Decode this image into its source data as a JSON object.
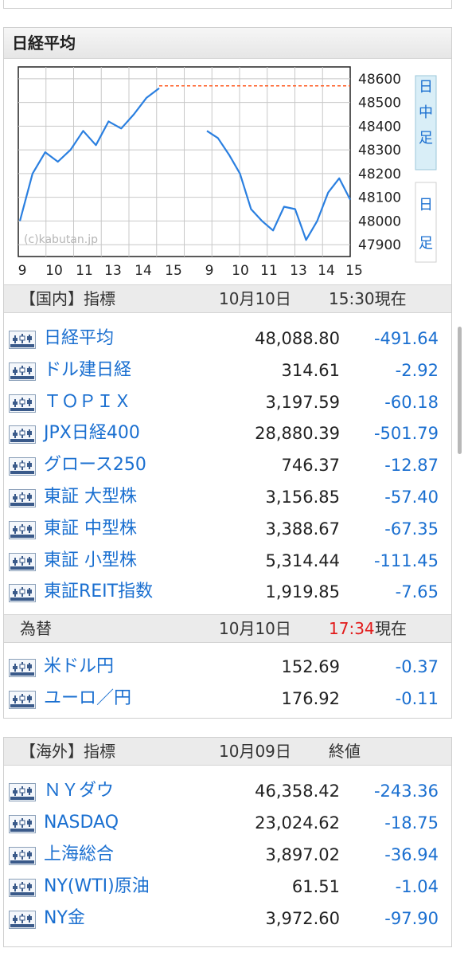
{
  "nikkei_panel": {
    "title": "日経平均",
    "chart": {
      "watermark": "(c)kabutan.jp",
      "right_labels": [
        "日",
        "中",
        "足",
        "日",
        "足"
      ],
      "y_ticks": [
        "48600",
        "48500",
        "48400",
        "48300",
        "48200",
        "48100",
        "48000",
        "47900"
      ],
      "x_ticks_left": [
        "9",
        "10",
        "11",
        "13",
        "14",
        "15"
      ],
      "x_ticks_right": [
        "9",
        "10",
        "11",
        "13",
        "14",
        "15"
      ]
    },
    "chart_data": {
      "type": "line",
      "ylim": [
        47850,
        48650
      ],
      "reference_line": 48570,
      "series": [
        {
          "values": [
            48000,
            48200,
            48290,
            48250,
            48300,
            48380,
            48320,
            48420,
            48390,
            48450,
            48520,
            48560
          ]
        },
        {
          "values": [
            48380,
            48350,
            48280,
            48200,
            48050,
            48000,
            47960,
            48060,
            48050,
            47920,
            48000,
            48120,
            48180,
            48090
          ]
        }
      ]
    },
    "domestic_header": {
      "label": "【国内】指標",
      "date": "10月10日",
      "time": "15:30現在"
    },
    "domestic_rows": [
      {
        "name": "日経平均",
        "value": "48,088.80",
        "change": "-491.64"
      },
      {
        "name": "ドル建日経",
        "value": "314.61",
        "change": "-2.92"
      },
      {
        "name": "ＴＯＰＩＸ",
        "value": "3,197.59",
        "change": "-60.18"
      },
      {
        "name": "JPX日経400",
        "value": "28,880.39",
        "change": "-501.79"
      },
      {
        "name": "グロース250",
        "value": "746.37",
        "change": "-12.87"
      },
      {
        "name": "東証 大型株",
        "value": "3,156.85",
        "change": "-57.40"
      },
      {
        "name": "東証 中型株",
        "value": "3,388.67",
        "change": "-67.35"
      },
      {
        "name": "東証 小型株",
        "value": "5,314.44",
        "change": "-111.45"
      },
      {
        "name": "東証REIT指数",
        "value": "1,919.85",
        "change": "-7.65"
      }
    ],
    "fx_header": {
      "label": "為替",
      "date": "10月10日",
      "time": "17:34",
      "suffix": "現在"
    },
    "fx_rows": [
      {
        "name": "米ドル円",
        "value": "152.69",
        "change": "-0.37"
      },
      {
        "name": "ユーロ／円",
        "value": "176.92",
        "change": "-0.11"
      }
    ]
  },
  "overseas_panel": {
    "header": {
      "label": "【海外】指標",
      "date": "10月09日",
      "time": "終値"
    },
    "rows": [
      {
        "name": "ＮＹダウ",
        "value": "46,358.42",
        "change": "-243.36"
      },
      {
        "name": "NASDAQ",
        "value": "23,024.62",
        "change": "-18.75"
      },
      {
        "name": "上海総合",
        "value": "3,897.02",
        "change": "-36.94"
      },
      {
        "name": "NY(WTI)原油",
        "value": "61.51",
        "change": "-1.04"
      },
      {
        "name": "NY金",
        "value": "3,972.60",
        "change": "-97.90"
      }
    ]
  },
  "colors": {
    "link": "#1a6fd0",
    "line": "#2a7fe0",
    "ref_line": "#ff5a1f",
    "time_red": "#e21a1a"
  }
}
